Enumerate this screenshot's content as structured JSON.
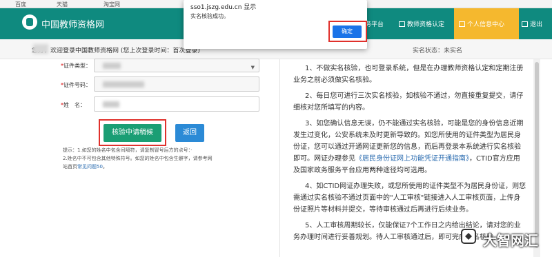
{
  "browser": {
    "bookmarks": [
      "百度",
      "天猫",
      "淘宝网",
      "",
      "",
      "",
      ""
    ]
  },
  "header": {
    "site_title": "中国教师资格网",
    "nav": [
      {
        "label": "业务平台",
        "icon": "monitor-icon"
      },
      {
        "label": "教师资格认定",
        "icon": "monitor-icon"
      },
      {
        "label": "个人信息中心",
        "icon": "user-icon",
        "active": true
      },
      {
        "label": "退出",
        "icon": "exit-icon"
      }
    ],
    "colors": {
      "brand": "#0f8a7f",
      "active": "#f5b82e"
    }
  },
  "status_bar": {
    "welcome": "您好，欢迎登录中国教师资格网 (您上次登录时间：首次登录)",
    "real_name_status": "实名状态：未实名"
  },
  "form": {
    "id_type_label": "证件类型：",
    "id_number_label": "证件号码：",
    "name_label": "姓　名：",
    "required_mark": "*",
    "verify_button": "核验中请稍候",
    "back_button": "返回",
    "hint_line1": "提示：1.如您的姓名中包含间隔符，请复制冒号后方的点号：·",
    "hint_line2": "2.姓名中不可包含其他特殊符号。如您的姓名中包含生僻字，请参考网",
    "hint_line3_prefix": "站首页",
    "hint_link": "常见问题50",
    "hint_line3_suffix": "。"
  },
  "notice": {
    "p1": "1、不做实名核验，也可登录系统，但是在办理教师资格认定和定期注册业务之前必须做实名核验。",
    "p2": "2、每日您可进行三次实名核验，如核验不通过，勿直接重复提交，请仔细核对您所填写的内容。",
    "p3_before_link": "3、如您确认信息无误，仍不能通过实名核验，可能是您的身份信息近期发生过变化，公安系统未及时更新导致的。如您所使用的证件类型为居民身份证，您可以通过开通网证更新您的信息，而后再登录本系统进行实名核验即可。网证办理参见",
    "p3_link": "《居民身份证网上功能凭证开通指南》",
    "p3_after_link": "，CTID官方应用及国家政务服务平台应用两种途径均可选用。",
    "p4": "4、如CTID网证办理失败，或您所使用的证件类型不为居民身份证，则您需通过实名核验不通过页面中的\"人工审核\"链接进入人工审核页面，上传身份证照片等材料并提交，等待审核通过后再进行后续业务。",
    "p5": "5、人工审核周期较长，仅能保证7个工作日之内给出结论，请对您的业务办理时间进行妥善规划。待人工审核通过后，即可完成实名核验。"
  },
  "alert": {
    "origin": "sso1.jszg.edu.cn 显示",
    "message": "实名核验成功。",
    "ok_button": "确定"
  },
  "watermark": {
    "text": "大智网汇"
  }
}
